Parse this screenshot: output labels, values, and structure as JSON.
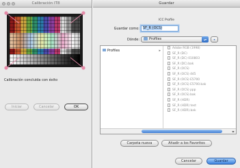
{
  "left_window": {
    "title": "Calibración IT8",
    "status": "Calibración concluida con éxito",
    "buttons": {
      "start": "Iniciar",
      "cancel": "Cancelar",
      "ok": "OK"
    }
  },
  "right_window": {
    "title": "Guardar",
    "subtitle": "ICC Profile",
    "save_as_label": "Guardar como:",
    "save_as_value": "SF_R (OCS)",
    "where_label": "Dónde:",
    "where_value": "Profiles",
    "sidebar_folder": "Profiles",
    "files": [
      "Adobe RGB (1998)",
      "SF_R (DC)",
      "SF_R (DC) 010803",
      "SF_R (DC).bak",
      "SF_R (OCS)",
      "SF_R (OCS) 445",
      "SF_R (OCS) E5700",
      "SF_R (OCS) E5700.bak",
      "SF_R (OCS) ppp",
      "SF_R (OCS).bak",
      "SF_R (HDR)",
      "SF_R (HDR) test",
      "SF_R (HDR).bak"
    ],
    "buttons": {
      "new_folder": "Carpeta nueva",
      "add_favorites": "Añadir a los Favoritos",
      "cancel": "Cancelar",
      "save": "Guardar"
    }
  },
  "colors": {
    "accent": "#3b82de",
    "window_bg": "#ececec",
    "corner_marker": "#e58aa8"
  }
}
